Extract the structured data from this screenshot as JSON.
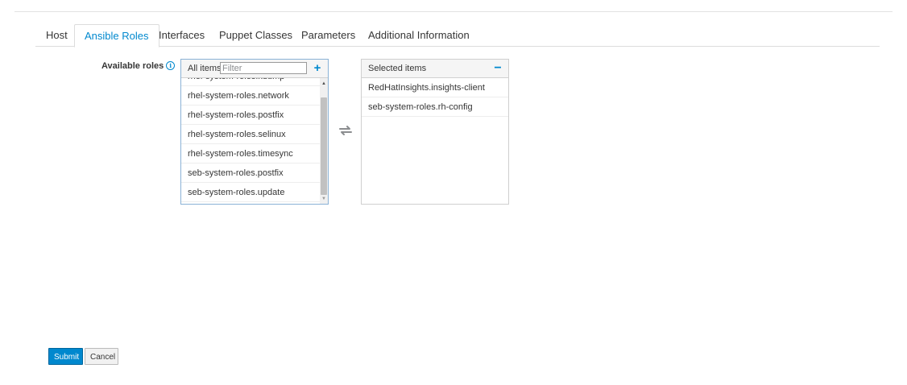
{
  "tabs": [
    {
      "label": "Host"
    },
    {
      "label": "Ansible Roles",
      "active": true
    },
    {
      "label": "Interfaces"
    },
    {
      "label": "Puppet Classes"
    },
    {
      "label": "Parameters"
    },
    {
      "label": "Additional Information"
    }
  ],
  "roles_field": {
    "label": "Available roles",
    "info_icon": "info-circle-icon"
  },
  "available": {
    "header": "All items",
    "filter_placeholder": "Filter",
    "filter_value": "",
    "add_icon": "plus-icon",
    "items": [
      "rhel-system-roles.network",
      "rhel-system-roles.postfix",
      "rhel-system-roles.selinux",
      "rhel-system-roles.timesync",
      "seb-system-roles.postfix",
      "seb-system-roles.update"
    ]
  },
  "selected": {
    "header": "Selected items",
    "remove_icon": "minus-icon",
    "items": [
      "RedHatInsights.insights-client",
      "seb-system-roles.rh-config"
    ]
  },
  "swap_icon": "exchange-icon",
  "buttons": {
    "submit": "Submit",
    "cancel": "Cancel"
  },
  "colors": {
    "accent": "#0088ce"
  }
}
